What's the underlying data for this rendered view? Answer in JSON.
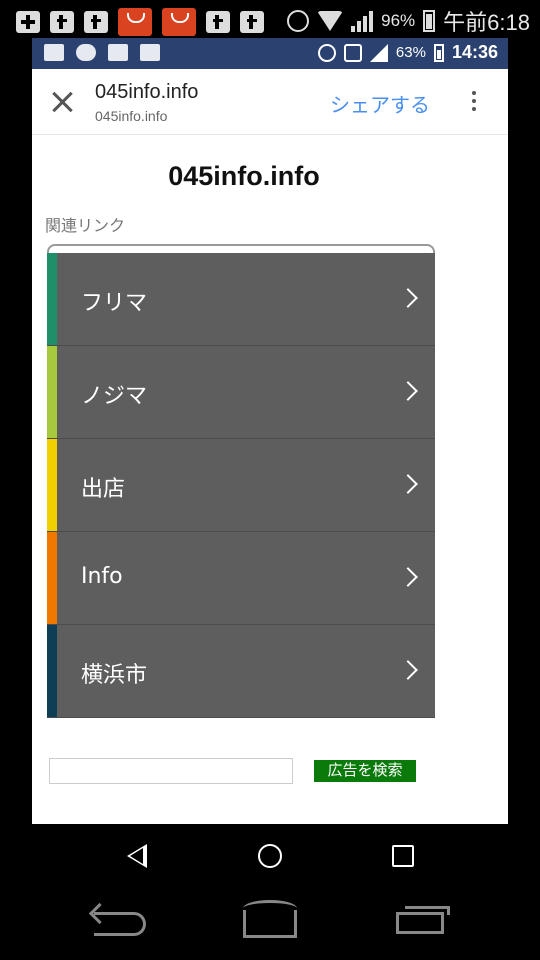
{
  "outer_status": {
    "battery": "96%",
    "time": "午前6:18"
  },
  "inner_status": {
    "battery": "63%",
    "time": "14:36"
  },
  "toolbar": {
    "title": "045info.info",
    "url": "045info.info",
    "share": "シェアする"
  },
  "page": {
    "title": "045info.info",
    "related_label": "関連リンク"
  },
  "links": [
    {
      "label": "フリマ",
      "color": "#1f8f6a"
    },
    {
      "label": "ノジマ",
      "color": "#a7c93d"
    },
    {
      "label": "出店",
      "color": "#f0d000"
    },
    {
      "label": "Info",
      "color": "#f07800"
    },
    {
      "label": "横浜市",
      "color": "#0d3e55"
    }
  ],
  "search": {
    "button": "広告を検索",
    "placeholder": ""
  }
}
